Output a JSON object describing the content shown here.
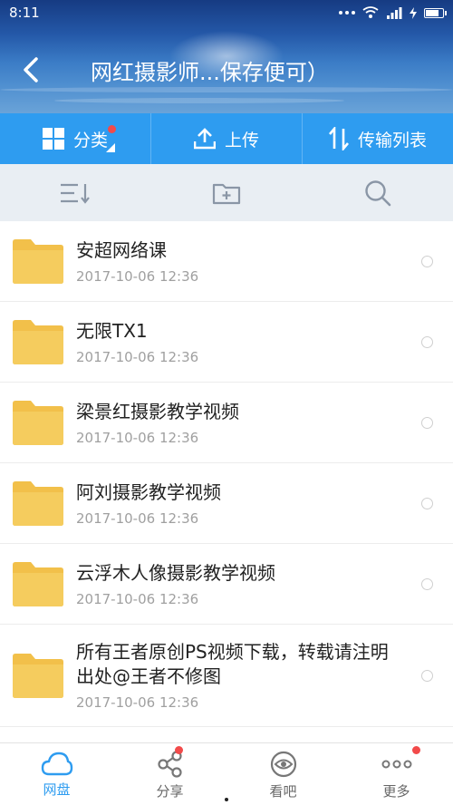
{
  "status_bar": {
    "time": "8:11"
  },
  "header": {
    "title": "网红摄影师...保存便可）"
  },
  "actions": [
    {
      "label": "分类",
      "icon": "grid-icon"
    },
    {
      "label": "上传",
      "icon": "upload-icon"
    },
    {
      "label": "传输列表",
      "icon": "transfer-icon"
    }
  ],
  "tools": [
    {
      "icon": "sort-icon"
    },
    {
      "icon": "new-folder-icon"
    },
    {
      "icon": "search-icon"
    }
  ],
  "files": [
    {
      "name": "安超网络课",
      "date": "2017-10-06  12:36"
    },
    {
      "name": "无限TX1",
      "date": "2017-10-06  12:36"
    },
    {
      "name": "梁景红摄影教学视频",
      "date": "2017-10-06  12:36"
    },
    {
      "name": "阿刘摄影教学视频",
      "date": "2017-10-06  12:36"
    },
    {
      "name": "云浮木人像摄影教学视频",
      "date": "2017-10-06  12:36"
    },
    {
      "name": "所有王者原创PS视频下载，转载请注明出处@王者不修图",
      "date": "2017-10-06  12:36"
    }
  ],
  "nav": [
    {
      "label": "网盘",
      "icon": "cloud-icon",
      "active": true
    },
    {
      "label": "分享",
      "icon": "share-icon"
    },
    {
      "label": "看吧",
      "icon": "eye-icon"
    },
    {
      "label": "更多",
      "icon": "more-icon"
    }
  ],
  "colors": {
    "accent": "#2e9cf0",
    "folder": "#f2c04a",
    "badge": "#f24a4a"
  }
}
